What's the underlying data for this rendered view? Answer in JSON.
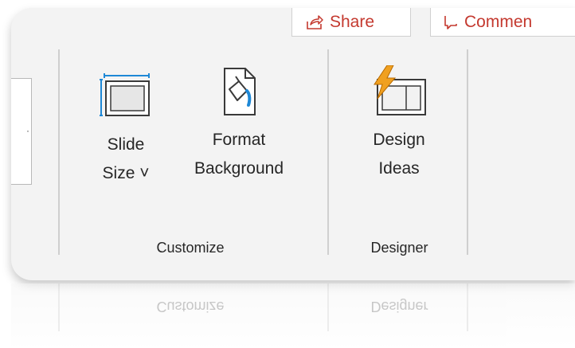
{
  "header": {
    "share_label": "Share",
    "comments_label": "Commen",
    "share_icon": "share-icon",
    "comments_icon": "comment-icon"
  },
  "groups": [
    {
      "label": "Customize",
      "commands": [
        {
          "line1": "Slide",
          "line2": "Size ˅",
          "icon": "slide-size-icon"
        },
        {
          "line1": "Format",
          "line2": "Background",
          "icon": "format-background-icon"
        }
      ]
    },
    {
      "label": "Designer",
      "commands": [
        {
          "line1": "Design",
          "line2": "Ideas",
          "icon": "design-ideas-icon"
        }
      ]
    }
  ],
  "colors": {
    "accent_red": "#c4392f",
    "icon_blue": "#1e88d6",
    "bolt_orange": "#f0a020",
    "ribbon_bg": "#f3f3f3"
  }
}
